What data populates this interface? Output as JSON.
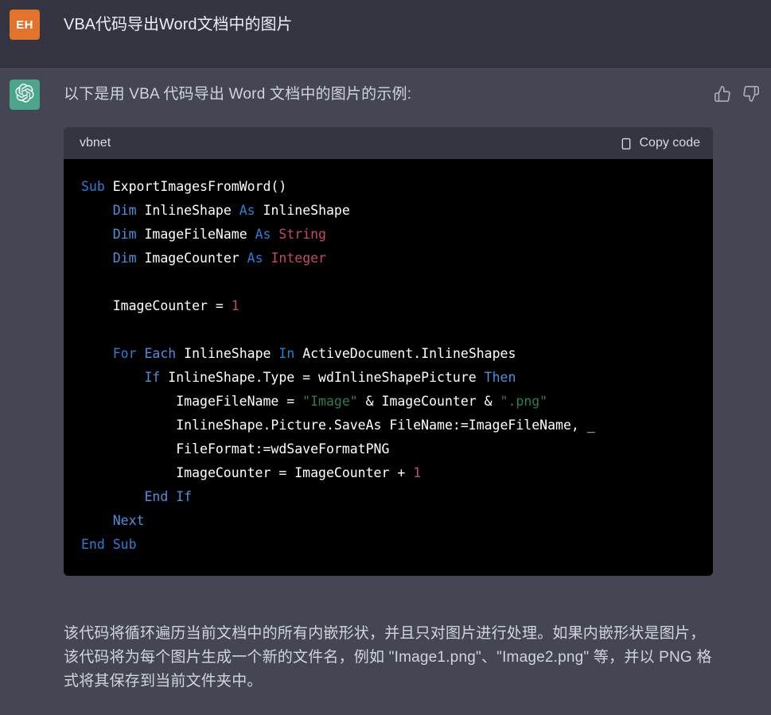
{
  "user": {
    "avatar_initials": "EH",
    "avatar_color": "#e2732c",
    "title": "VBA代码导出Word文档中的图片"
  },
  "assistant": {
    "avatar_color": "#4aa58b",
    "avatar_icon": "openai-logo-icon",
    "intro_text": "以下是用 VBA 代码导出 Word 文档中的图片的示例:",
    "closing_text": "该代码将循环遍历当前文档中的所有内嵌形状，并且只对图片进行处理。如果内嵌形状是图片，该代码将为每个图片生成一个新的文件名，例如 \"Image1.png\"、\"Image2.png\" 等，并以 PNG 格式将其保存到当前文件夹中。",
    "feedback": {
      "thumbs_up_icon": "thumbs-up-icon",
      "thumbs_down_icon": "thumbs-down-icon"
    }
  },
  "code_block": {
    "language_label": "vbnet",
    "copy_label": "Copy code",
    "copy_icon": "clipboard-icon",
    "background_color": "#000000",
    "header_background_color": "#343541",
    "lines": [
      [
        {
          "t": "Sub ",
          "c": "kw"
        },
        {
          "t": "ExportImagesFromWord()",
          "c": "txt"
        }
      ],
      [
        {
          "t": "    ",
          "c": "txt"
        },
        {
          "t": "Dim ",
          "c": "kw2"
        },
        {
          "t": "InlineShape ",
          "c": "txt"
        },
        {
          "t": "As ",
          "c": "kw"
        },
        {
          "t": "InlineShape",
          "c": "txt"
        }
      ],
      [
        {
          "t": "    ",
          "c": "txt"
        },
        {
          "t": "Dim ",
          "c": "kw2"
        },
        {
          "t": "ImageFileName ",
          "c": "txt"
        },
        {
          "t": "As ",
          "c": "kw"
        },
        {
          "t": "String",
          "c": "type"
        }
      ],
      [
        {
          "t": "    ",
          "c": "txt"
        },
        {
          "t": "Dim ",
          "c": "kw2"
        },
        {
          "t": "ImageCounter ",
          "c": "txt"
        },
        {
          "t": "As ",
          "c": "kw"
        },
        {
          "t": "Integer",
          "c": "type"
        }
      ],
      [],
      [
        {
          "t": "    ImageCounter = ",
          "c": "txt"
        },
        {
          "t": "1",
          "c": "num"
        }
      ],
      [],
      [
        {
          "t": "    ",
          "c": "txt"
        },
        {
          "t": "For ",
          "c": "kw"
        },
        {
          "t": "Each ",
          "c": "kw2"
        },
        {
          "t": "InlineShape ",
          "c": "txt"
        },
        {
          "t": "In ",
          "c": "kw"
        },
        {
          "t": "ActiveDocument.InlineShapes",
          "c": "txt"
        }
      ],
      [
        {
          "t": "        ",
          "c": "txt"
        },
        {
          "t": "If ",
          "c": "kw2"
        },
        {
          "t": "InlineShape.Type = wdInlineShapePicture ",
          "c": "txt"
        },
        {
          "t": "Then",
          "c": "kw2"
        }
      ],
      [
        {
          "t": "            ImageFileName = ",
          "c": "txt"
        },
        {
          "t": "\"Image\"",
          "c": "str"
        },
        {
          "t": " & ImageCounter & ",
          "c": "txt"
        },
        {
          "t": "\".png\"",
          "c": "str"
        }
      ],
      [
        {
          "t": "            InlineShape.Picture.SaveAs FileName:=ImageFileName, _",
          "c": "txt"
        }
      ],
      [
        {
          "t": "            FileFormat:=wdSaveFormatPNG",
          "c": "txt"
        }
      ],
      [
        {
          "t": "            ImageCounter = ImageCounter + ",
          "c": "txt"
        },
        {
          "t": "1",
          "c": "num"
        }
      ],
      [
        {
          "t": "        ",
          "c": "txt"
        },
        {
          "t": "End If",
          "c": "kw2"
        }
      ],
      [
        {
          "t": "    ",
          "c": "txt"
        },
        {
          "t": "Next",
          "c": "kw2"
        }
      ],
      [
        {
          "t": "End Sub",
          "c": "kw"
        }
      ]
    ]
  }
}
